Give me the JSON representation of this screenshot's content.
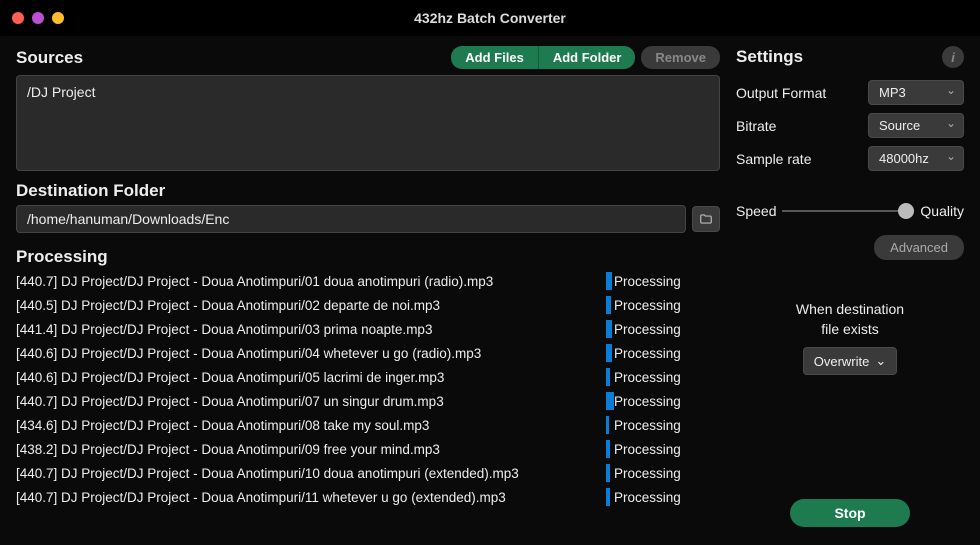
{
  "window": {
    "title": "432hz Batch Converter"
  },
  "sources": {
    "title": "Sources",
    "add_files_label": "Add Files",
    "add_folder_label": "Add Folder",
    "remove_label": "Remove",
    "items": [
      "/DJ Project"
    ]
  },
  "destination": {
    "title": "Destination Folder",
    "path": "/home/hanuman/Downloads/Enc"
  },
  "processing": {
    "title": "Processing",
    "status_label": "Processing",
    "files": [
      {
        "freq": "440.7",
        "path": "DJ Project/DJ Project - Doua Anotimpuri/01 doua anotimpuri (radio).mp3",
        "progress": 6
      },
      {
        "freq": "440.5",
        "path": "DJ Project/DJ Project - Doua Anotimpuri/02 departe de noi.mp3",
        "progress": 5
      },
      {
        "freq": "441.4",
        "path": "DJ Project/DJ Project - Doua Anotimpuri/03 prima noapte.mp3",
        "progress": 6
      },
      {
        "freq": "440.6",
        "path": "DJ Project/DJ Project - Doua Anotimpuri/04 whetever u go (radio).mp3",
        "progress": 6
      },
      {
        "freq": "440.6",
        "path": "DJ Project/DJ Project - Doua Anotimpuri/05 lacrimi de inger.mp3",
        "progress": 4
      },
      {
        "freq": "440.7",
        "path": "DJ Project/DJ Project - Doua Anotimpuri/07 un singur drum.mp3",
        "progress": 8
      },
      {
        "freq": "434.6",
        "path": "DJ Project/DJ Project - Doua Anotimpuri/08 take my soul.mp3",
        "progress": 3
      },
      {
        "freq": "438.2",
        "path": "DJ Project/DJ Project - Doua Anotimpuri/09 free your mind.mp3",
        "progress": 4
      },
      {
        "freq": "440.7",
        "path": "DJ Project/DJ Project - Doua Anotimpuri/10 doua anotimpuri (extended).mp3",
        "progress": 4
      },
      {
        "freq": "440.7",
        "path": "DJ Project/DJ Project - Doua Anotimpuri/11 whetever u go (extended).mp3",
        "progress": 4
      }
    ]
  },
  "settings": {
    "title": "Settings",
    "output_format_label": "Output Format",
    "output_format_value": "MP3",
    "bitrate_label": "Bitrate",
    "bitrate_value": "Source",
    "sample_rate_label": "Sample rate",
    "sample_rate_value": "48000hz",
    "speed_label": "Speed",
    "quality_label": "Quality",
    "advanced_label": "Advanced",
    "dest_exists_line1": "When destination",
    "dest_exists_line2": "file exists",
    "overwrite_value": "Overwrite",
    "stop_label": "Stop"
  }
}
